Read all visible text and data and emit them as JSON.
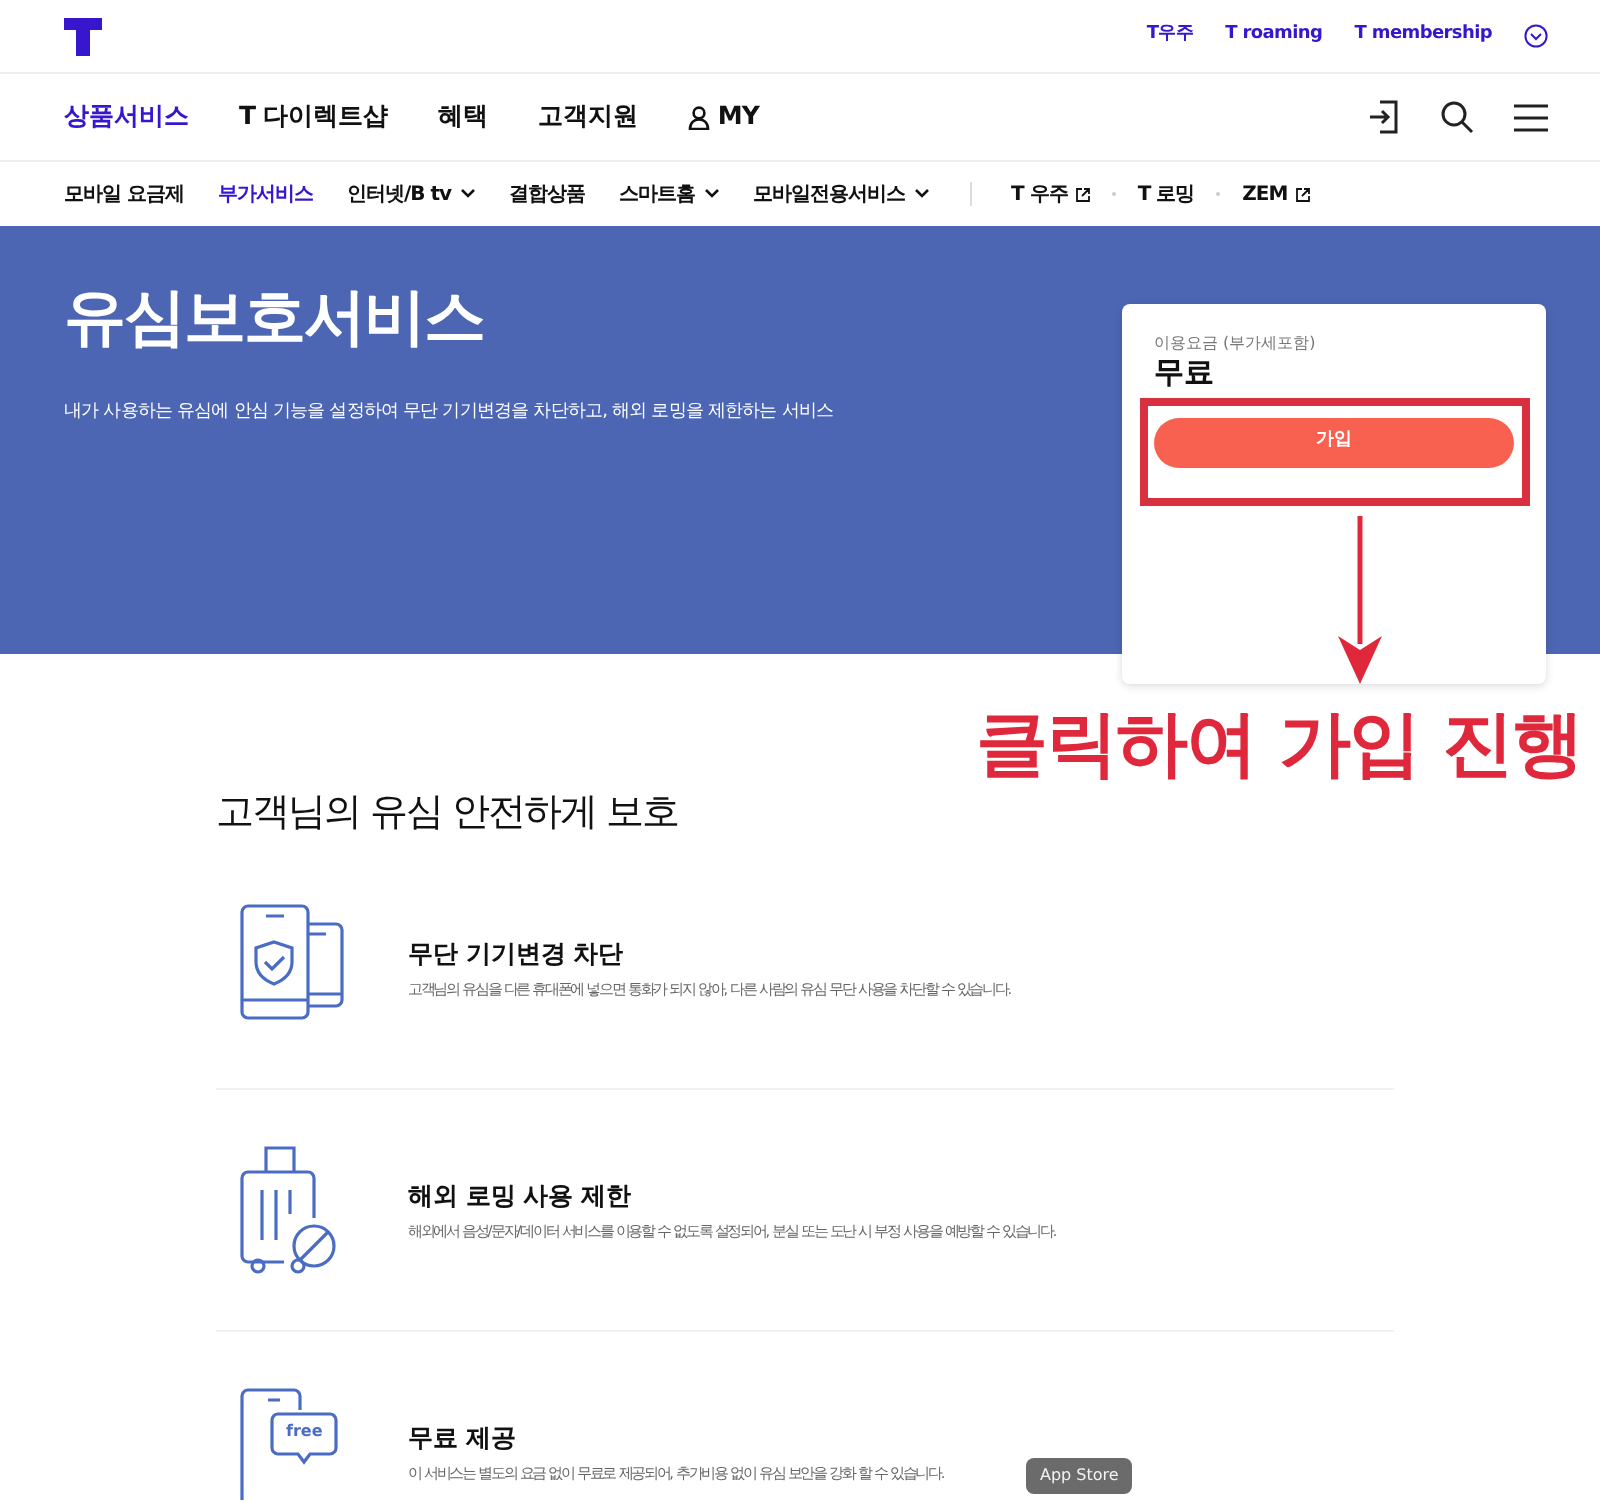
{
  "utility_links": [
    {
      "label": "T우주"
    },
    {
      "label": "T roaming"
    },
    {
      "label": "T membership"
    }
  ],
  "main_nav": [
    {
      "label": "상품서비스",
      "selected": true,
      "kind": "plain"
    },
    {
      "label": "T 다이렉트샵",
      "selected": false,
      "kind": "plain"
    },
    {
      "label": "혜택",
      "selected": false,
      "kind": "plain"
    },
    {
      "label": "고객지원",
      "selected": false,
      "kind": "plain"
    },
    {
      "label": "MY",
      "selected": false,
      "kind": "user"
    }
  ],
  "sub_nav": [
    {
      "label": "모바일 요금제",
      "selected": false,
      "kind": "plain"
    },
    {
      "label": "부가서비스",
      "selected": true,
      "kind": "plain"
    },
    {
      "label": "인터넷/B tv",
      "selected": false,
      "kind": "dropdown"
    },
    {
      "label": "결합상품",
      "selected": false,
      "kind": "plain"
    },
    {
      "label": "스마트홈",
      "selected": false,
      "kind": "dropdown"
    },
    {
      "label": "모바일전용서비스",
      "selected": false,
      "kind": "dropdown"
    }
  ],
  "external_links": [
    {
      "label": "T 우주",
      "external": true
    },
    {
      "label": "T 로밍",
      "external": false
    },
    {
      "label": "ZEM",
      "external": true
    }
  ],
  "hero": {
    "title": "유심보호서비스",
    "description": "내가 사용하는 유심에 안심 기능을 설정하여 무단 기기변경을 차단하고, 해외 로밍을 제한하는 서비스"
  },
  "price_card": {
    "label": "이용요금 (부가세포함)",
    "price": "무료",
    "button": "가입"
  },
  "annotation": {
    "text": "클릭하여 가입 진행"
  },
  "section": {
    "heading": "고객님의 유심 안전하게 보호",
    "features": [
      {
        "kind": "phone-shield",
        "title": "무단 기기변경 차단",
        "description": "고객님의 유심을 다른 휴대폰에 넣으면 통화가 되지 않아, 다른 사람의 유심 무단 사용을 차단할 수 있습니다."
      },
      {
        "kind": "luggage-ban",
        "title": "해외 로밍 사용 제한",
        "description": "해외에서 음성/문자/데이터 서비스를 이용할 수 없도록 설정되어, 분실 또는 도난 시 부정 사용을 예방할 수 있습니다."
      },
      {
        "kind": "free-chat",
        "icon_label": "free",
        "title": "무료 제공",
        "description": "이 서비스는 별도의 요금 없이 무료로 제공되어, 추가비용 없이 유심 보안을 강화 할 수 있습니다."
      }
    ]
  },
  "tooltip": {
    "text": "App Store"
  }
}
